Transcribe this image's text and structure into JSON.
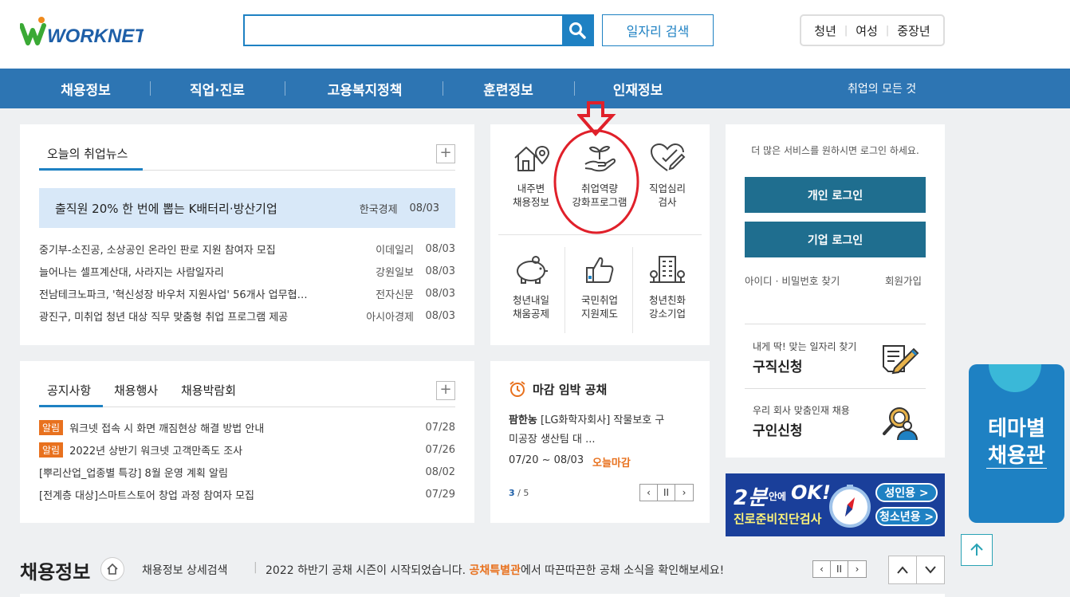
{
  "header": {
    "logo_text": "WORKNET",
    "search_placeholder": "",
    "job_search_label": "일자리 검색",
    "age_links": [
      "청년",
      "여성",
      "중장년"
    ]
  },
  "nav": {
    "items": [
      "채용정보",
      "직업·진로",
      "고용복지정책",
      "훈련정보",
      "인재정보"
    ],
    "all_label": "취업의 모든 것"
  },
  "news": {
    "tab_label": "오늘의 취업뉴스",
    "plus": "+",
    "headline": {
      "title": "출직원 20% 한 번에 뽑는 K배터리·방산기업",
      "source": "한국경제",
      "date": "08/03"
    },
    "items": [
      {
        "title": "중기부-소진공, 소상공인 온라인 판로 지원 참여자 모집",
        "source": "이데일리",
        "date": "08/03"
      },
      {
        "title": "늘어나는 셀프계산대, 사라지는 사람일자리",
        "source": "강원일보",
        "date": "08/03"
      },
      {
        "title": "전남테크노파크, '혁신성장 바우처 지원사업' 56개사 업무협…",
        "source": "전자신문",
        "date": "08/03"
      },
      {
        "title": "광진구, 미취업 청년 대상 직무 맞춤형 취업 프로그램 제공",
        "source": "아시아경제",
        "date": "08/03"
      }
    ]
  },
  "services": [
    {
      "line1": "내주변",
      "line2": "채용정보"
    },
    {
      "line1": "취업역량",
      "line2": "강화프로그램"
    },
    {
      "line1": "직업심리",
      "line2": "검사"
    },
    {
      "line1": "청년내일",
      "line2": "채움공제"
    },
    {
      "line1": "국민취업",
      "line2": "지원제도"
    },
    {
      "line1": "청년친화",
      "line2": "강소기업"
    }
  ],
  "login": {
    "message": "더 많은 서비스를 원하시면 로그인 하세요.",
    "personal_label": "개인 로그인",
    "company_label": "기업 로그인",
    "find_label": "아이디 · 비밀번호 찾기",
    "signup_label": "회원가입"
  },
  "job_seek": {
    "subtitle": "내게 딱! 맞는 일자리 찾기",
    "title": "구직신청"
  },
  "job_offer": {
    "subtitle": "우리 회사 맞춤인재 채용",
    "title": "구인신청"
  },
  "notices": {
    "tabs": [
      "공지사항",
      "채용행사",
      "채용박람회"
    ],
    "plus": "+",
    "badge": "알림",
    "items": [
      {
        "badge": true,
        "title": "워크넷 접속 시 화면 깨짐현상 해결 방법 안내",
        "date": "07/28"
      },
      {
        "badge": true,
        "title": "2022년 상반기 워크넷 고객만족도 조사",
        "date": "07/26"
      },
      {
        "badge": false,
        "title": "[뿌리산업_업종별 특강] 8월 운영 계획 알림",
        "date": "08/02"
      },
      {
        "badge": false,
        "title": "[전계층 대상]스마트스토어 창업 과정 참여자 모집",
        "date": "07/29"
      }
    ]
  },
  "deadline": {
    "title": "마감 임박 공채",
    "company": "팜한농",
    "desc1": "[LG화학자회사] 작물보호 구",
    "desc2": "미공장 생산팀 대 ...",
    "period": "07/20 ~ 08/03",
    "today": "오늘마감",
    "page_current": "3",
    "page_total": "/ 5"
  },
  "banner": {
    "big": "2분",
    "mid": "안에",
    "ok": "OK!",
    "sub": "진로준비진단검사",
    "adult": "성인용 >",
    "youth": "청소년용 >"
  },
  "theme": {
    "line1": "테마별",
    "line2": "채용관"
  },
  "bottom": {
    "title": "채용정보",
    "detail_search": "채용정보 상세검색",
    "msg_pre": "2022 하반기 공채 시즌이 시작되었습니다.",
    "msg_highlight": "공채특별관",
    "msg_post": "에서 따끈따끈한 공채 소식을 확인해보세요!"
  },
  "colors": {
    "brand_blue": "#2d75b3",
    "login_btn": "#1f6e8f",
    "accent_orange": "#e8711e",
    "annotation_red": "#e0202a"
  }
}
